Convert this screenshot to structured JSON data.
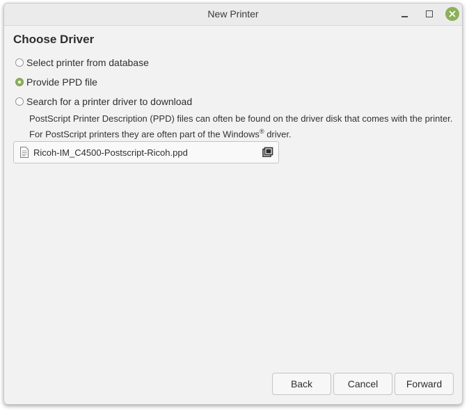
{
  "window": {
    "title": "New Printer",
    "controls": {
      "minimize_icon": "minimize-icon",
      "maximize_icon": "maximize-icon",
      "close_icon": "close-icon",
      "close_color": "#8cb05a"
    }
  },
  "page": {
    "heading": "Choose Driver",
    "options": [
      {
        "label": "Select printer from database",
        "selected": false
      },
      {
        "label": "Provide PPD file",
        "selected": true
      },
      {
        "label": "Search for a printer driver to download",
        "selected": false
      }
    ],
    "description_part1": "PostScript Printer Description (PPD) files can often be found on the driver disk that comes with the printer. For PostScript printers they are often part of the Windows",
    "description_sup": "®",
    "description_part2": " driver.",
    "file_chooser": {
      "file_name": "Ricoh-IM_C4500-Postscript-Ricoh.ppd",
      "file_icon": "document-icon",
      "open_icon": "open-file-icon"
    }
  },
  "buttons": {
    "back": "Back",
    "cancel": "Cancel",
    "forward": "Forward"
  },
  "colors": {
    "accent": "#8cb05a",
    "background": "#f2f2f2"
  }
}
